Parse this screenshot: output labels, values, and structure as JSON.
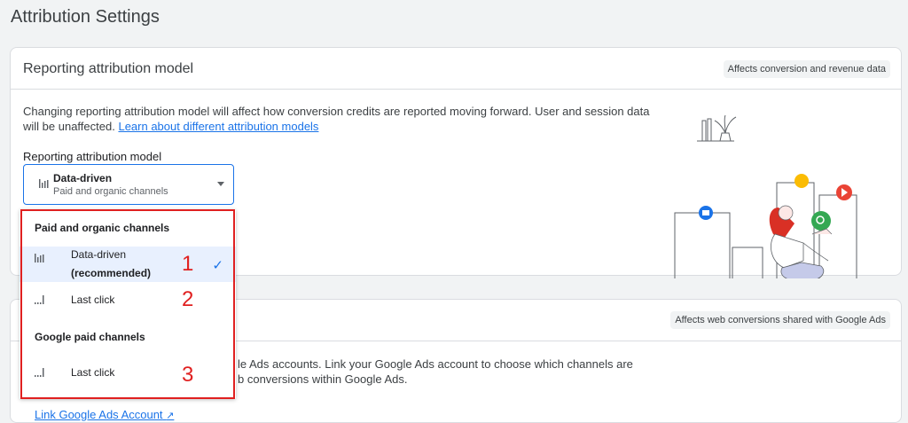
{
  "page": {
    "title": "Attribution Settings"
  },
  "card1": {
    "title": "Reporting attribution model",
    "chip": "Affects conversion and revenue data",
    "desc_text": "Changing reporting attribution model will affect how conversion credits are reported moving forward. User and session data will be unaffected.",
    "desc_link": "Learn about different attribution models",
    "field_label": "Reporting attribution model",
    "select": {
      "value": "Data-driven",
      "subvalue": "Paid and organic channels",
      "icon": "bar-chart-icon"
    }
  },
  "card2": {
    "chip": "Affects web conversions shared with Google Ads",
    "text_line1": "le Ads accounts. Link your Google Ads account to choose which channels are",
    "text_line2": "b conversions within Google Ads.",
    "link": "Link Google Ads Account"
  },
  "dropdown": {
    "groups": [
      {
        "label": "Paid and organic channels",
        "items": [
          {
            "label_line1": "Data-driven",
            "label_line2": "(recommended)",
            "selected": true,
            "annotation": "1"
          },
          {
            "label_line1": "Last click",
            "selected": false,
            "annotation": "2"
          }
        ]
      },
      {
        "label": "Google paid channels",
        "items": [
          {
            "label_line1": "Last click",
            "selected": false,
            "annotation": "3"
          }
        ]
      }
    ],
    "check_icon": "check-icon"
  },
  "colors": {
    "accent": "#1a73e8",
    "annotation": "#e02020",
    "selected_bg": "#e8f0fe"
  }
}
